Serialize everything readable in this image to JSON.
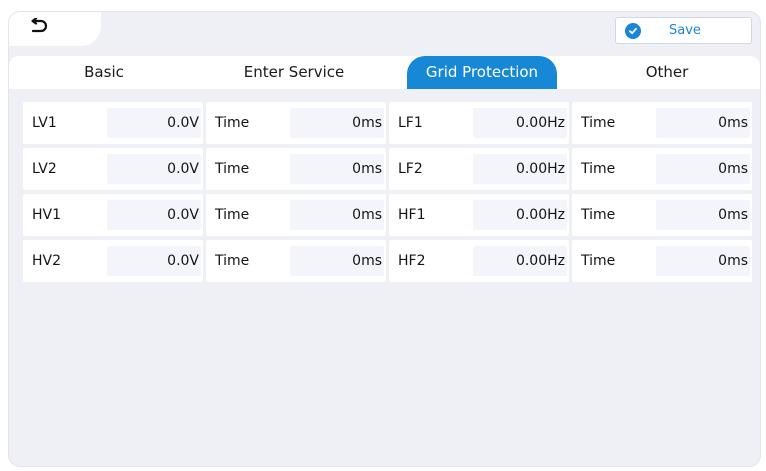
{
  "header": {
    "save_label": "Save",
    "accent_color": "#1788d6"
  },
  "tabs": [
    {
      "label": "Basic",
      "active": false
    },
    {
      "label": "Enter Service",
      "active": false
    },
    {
      "label": "Grid Protection",
      "active": true
    },
    {
      "label": "Other",
      "active": false
    }
  ],
  "rows": [
    [
      {
        "label": "LV1",
        "value": "0.0V"
      },
      {
        "label": "Time",
        "value": "0ms"
      },
      {
        "label": "LF1",
        "value": "0.00Hz"
      },
      {
        "label": "Time",
        "value": "0ms"
      }
    ],
    [
      {
        "label": "LV2",
        "value": "0.0V"
      },
      {
        "label": "Time",
        "value": "0ms"
      },
      {
        "label": "LF2",
        "value": "0.00Hz"
      },
      {
        "label": "Time",
        "value": "0ms"
      }
    ],
    [
      {
        "label": "HV1",
        "value": "0.0V"
      },
      {
        "label": "Time",
        "value": "0ms"
      },
      {
        "label": "HF1",
        "value": "0.00Hz"
      },
      {
        "label": "Time",
        "value": "0ms"
      }
    ],
    [
      {
        "label": "HV2",
        "value": "0.0V"
      },
      {
        "label": "Time",
        "value": "0ms"
      },
      {
        "label": "HF2",
        "value": "0.00Hz"
      },
      {
        "label": "Time",
        "value": "0ms"
      }
    ]
  ]
}
